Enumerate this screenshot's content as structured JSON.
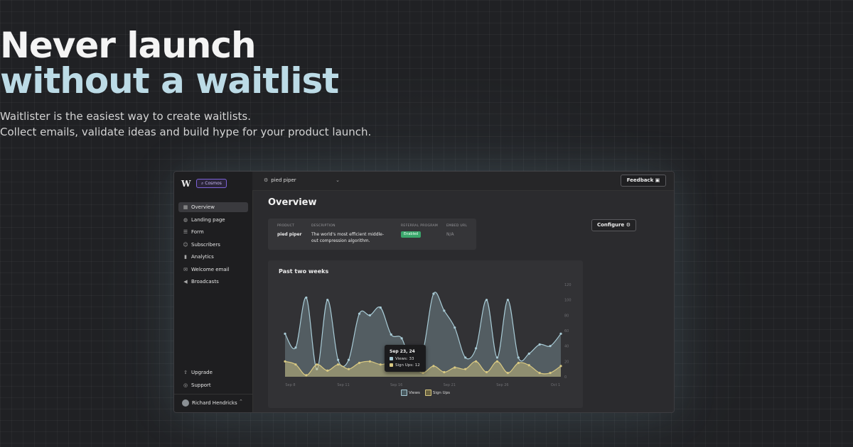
{
  "hero": {
    "title_line1": "Never launch",
    "title_line2": "without a waitlist",
    "subtitle_line1": "Waitlister is the easiest way to create waitlists.",
    "subtitle_line2": "Collect emails, validate ideas and build hype for your product launch."
  },
  "colors": {
    "accent_title": "#bcdbe6",
    "views_line": "#a8cbd6",
    "signups_line": "#d9c982",
    "enabled_green": "#3aa66b",
    "workspace_purple": "#7d63d8"
  },
  "sidebar": {
    "logo": "W",
    "workspace": "Cosmos",
    "items": [
      {
        "label": "Overview",
        "icon": "grid-icon",
        "active": true
      },
      {
        "label": "Landing page",
        "icon": "globe-icon",
        "active": false
      },
      {
        "label": "Form",
        "icon": "form-icon",
        "active": false
      },
      {
        "label": "Subscribers",
        "icon": "users-icon",
        "active": false
      },
      {
        "label": "Analytics",
        "icon": "bar-chart-icon",
        "active": false
      },
      {
        "label": "Welcome email",
        "icon": "mail-icon",
        "active": false
      },
      {
        "label": "Broadcasts",
        "icon": "megaphone-icon",
        "active": false
      }
    ],
    "bottom_items": [
      {
        "label": "Upgrade",
        "icon": "arrow-up-icon"
      },
      {
        "label": "Support",
        "icon": "help-icon"
      }
    ],
    "user": {
      "name": "Richard Hendricks"
    }
  },
  "topbar": {
    "project": "pied piper",
    "feedback_label": "Feedback"
  },
  "main": {
    "title": "Overview",
    "configure_label": "Configure",
    "info": {
      "headers": [
        "PRODUCT",
        "DESCRIPTION",
        "REFERRAL PROGRAM",
        "EMBED URL"
      ],
      "product": "pied piper",
      "description_line1": "The world's most efficient middle-",
      "description_line2": "out compression algorithm.",
      "referral": "Enabled",
      "embed_url": "N/A"
    }
  },
  "chart_data": {
    "type": "area",
    "title": "Past two weeks",
    "x_ticks": [
      "Sep 8",
      "Sep 11",
      "Sep 16",
      "Sep 21",
      "Sep 26",
      "Oct 1"
    ],
    "y_ticks": [
      0,
      20,
      40,
      60,
      80,
      100,
      120
    ],
    "ylim": [
      0,
      120
    ],
    "series": [
      {
        "name": "Views",
        "values": [
          56,
          38,
          103,
          10,
          100,
          22,
          22,
          82,
          80,
          90,
          55,
          50,
          15,
          33,
          108,
          86,
          64,
          25,
          37,
          100,
          25,
          100,
          25,
          30,
          42,
          40,
          56
        ]
      },
      {
        "name": "Sign Ups",
        "values": [
          20,
          16,
          2,
          16,
          8,
          16,
          10,
          18,
          20,
          16,
          18,
          12,
          14,
          5,
          14,
          6,
          12,
          10,
          20,
          6,
          20,
          5,
          18,
          15,
          5,
          5,
          14
        ]
      }
    ],
    "legend_position": "bottom-center",
    "tooltip": {
      "date": "Sep 23, 24",
      "views_label": "Views",
      "views_value": 33,
      "signups_label": "Sign Ups",
      "signups_value": 12
    }
  }
}
